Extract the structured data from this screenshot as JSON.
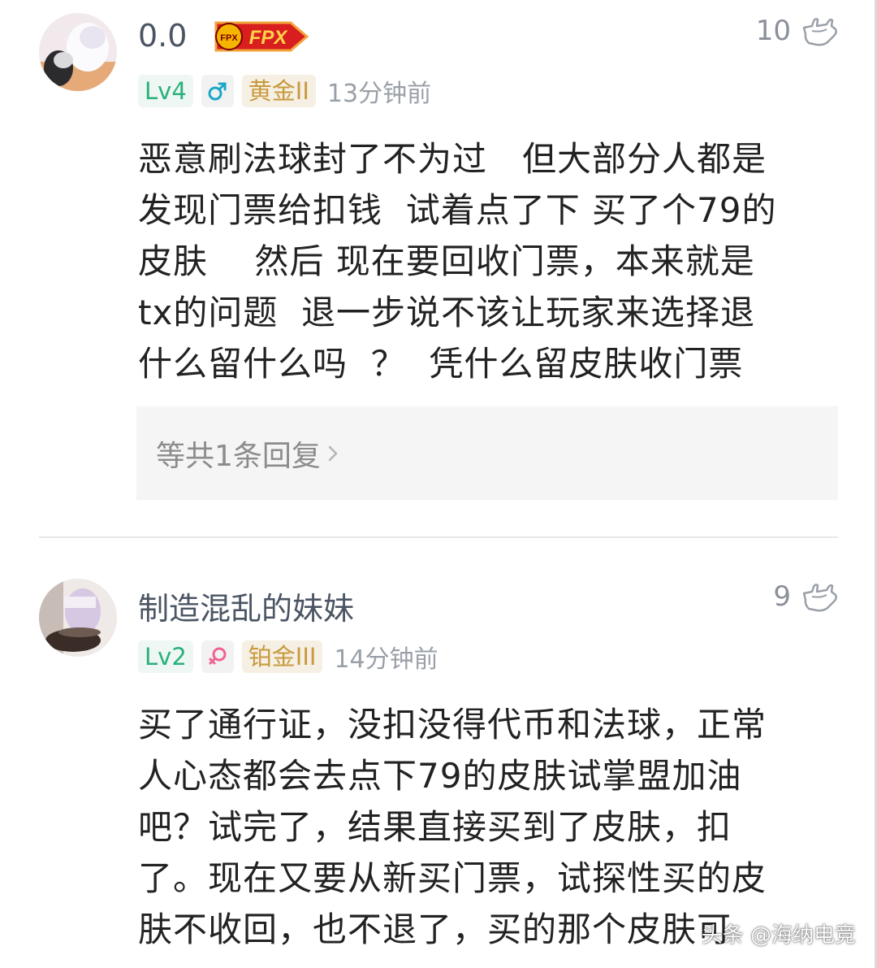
{
  "comments": [
    {
      "username": "0.0",
      "team_badge": "FPX",
      "team_badge_small": "FPX",
      "likes": "10",
      "level": "Lv4",
      "gender_icon": "male-icon",
      "rank": "黄金II",
      "time": "13分钟前",
      "text": "恶意刷法球封了不为过   但大部分人都是\n发现门票给扣钱  试着点了下 买了个79的\n皮肤    然后 现在要回收门票，本来就是\ntx的问题  退一步说不该让玩家来选择退\n什么留什么吗  ？  凭什么留皮肤收门票",
      "reply_label": "等共1条回复",
      "colors": {
        "level": "#2ab07a",
        "gender": "#1aa7c8",
        "rank": "#c79a3e"
      }
    },
    {
      "username": "制造混乱的妹妹",
      "likes": "9",
      "level": "Lv2",
      "gender_icon": "female-icon",
      "rank": "铂金III",
      "time": "14分钟前",
      "text": "买了通行证，没扣没得代币和法球，正常\n人心态都会去点下79的皮肤试掌盟加油\n吧？试完了，结果直接买到了皮肤，扣\n了。现在又要从新买门票，试探性买的皮\n肤不收回，也不退了，买的那个皮肤可",
      "colors": {
        "level": "#2ab07a",
        "gender": "#f06292",
        "rank": "#c79a3e"
      }
    }
  ],
  "watermark": "头条 @海纳电竞"
}
